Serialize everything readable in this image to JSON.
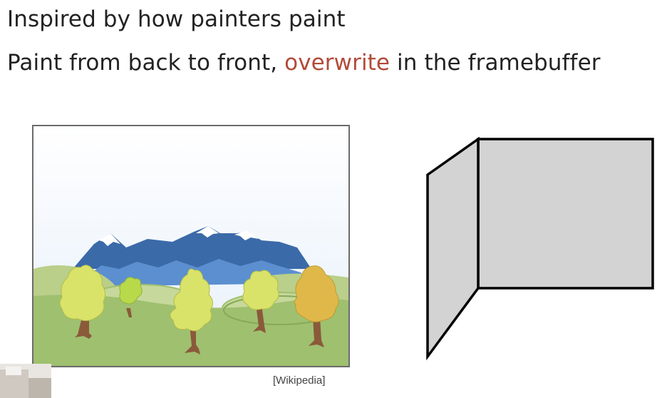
{
  "slide": {
    "line1": "Inspired by how painters paint",
    "line2_before": "Paint from back to front, ",
    "line2_accent": "overwrite",
    "line2_after": " in the framebuffer",
    "caption": "[Wikipedia]"
  },
  "colors": {
    "text": "#222222",
    "accent": "#b24a38",
    "sky_top": "#ffffff",
    "sky_bottom": "#e6f0fb",
    "mountain_dark": "#3b6aa8",
    "mountain_light": "#5b8fd0",
    "snow": "#ffffff",
    "hill_back": "#b9cf8a",
    "ground": "#9fc06f",
    "tree_yellow": "#d9e36a",
    "tree_green": "#b7d94a",
    "tree_gold": "#e0b84a",
    "trunk": "#8a5a3a",
    "wall_fill": "#d3d3d3",
    "wall_stroke": "#000000"
  },
  "icons": {
    "painting": "landscape-painting",
    "walls": "folded-wall-shape"
  }
}
